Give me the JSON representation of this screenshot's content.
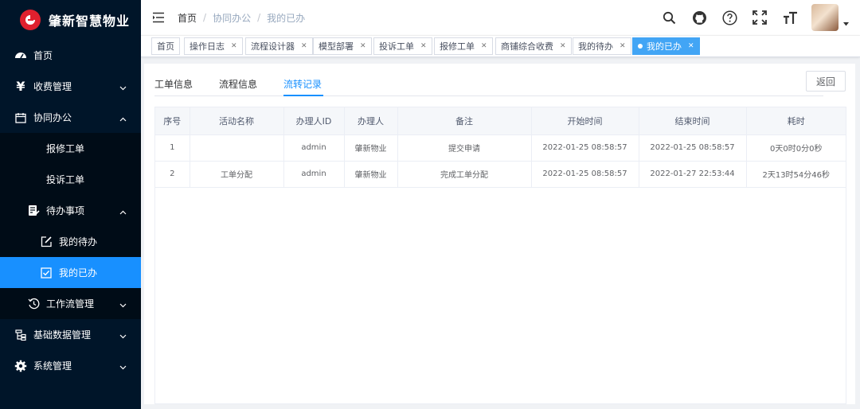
{
  "app": {
    "title": "肇新智慧物业"
  },
  "sidebar": {
    "home": "首页",
    "fee": "收费管理",
    "office": "协同办公",
    "repair": "报修工单",
    "complaint": "投诉工单",
    "todo_group": "待办事项",
    "my_todo": "我的待办",
    "my_done": "我的已办",
    "workflow": "工作流管理",
    "basic": "基础数据管理",
    "system": "系统管理"
  },
  "breadcrumb": {
    "home": "首页",
    "office": "协同办公",
    "current": "我的已办"
  },
  "tags": [
    "首页",
    "操作日志",
    "流程设计器",
    "模型部署",
    "投诉工单",
    "报修工单",
    "商铺综合收费",
    "我的待办",
    "我的已办"
  ],
  "tabs": {
    "info": "工单信息",
    "flow": "流程信息",
    "transfer": "流转记录"
  },
  "back_label": "返回",
  "table": {
    "headers": [
      "序号",
      "活动名称",
      "办理人ID",
      "办理人",
      "备注",
      "开始时间",
      "结束时间",
      "耗时"
    ],
    "rows": [
      [
        "1",
        "",
        "admin",
        "肇新物业",
        "提交申请",
        "2022-01-25 08:58:57",
        "2022-01-25 08:58:57",
        "0天0时0分0秒"
      ],
      [
        "2",
        "工单分配",
        "admin",
        "肇新物业",
        "完成工单分配",
        "2022-01-25 08:58:57",
        "2022-01-27 22:53:44",
        "2天13时54分46秒"
      ]
    ]
  }
}
